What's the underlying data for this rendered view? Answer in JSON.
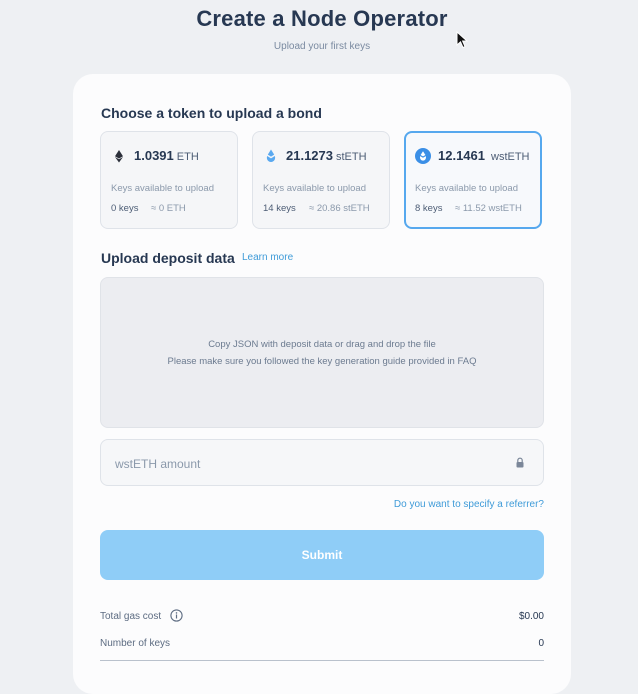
{
  "header": {
    "title": "Create a Node Operator",
    "subtitle": "Upload your first keys"
  },
  "bond": {
    "heading": "Choose a token to upload a bond",
    "tokens": [
      {
        "amount": "1.0391",
        "unit": "ETH",
        "available_label": "Keys available to upload",
        "keys": "0 keys",
        "equivalent": "≈ 0 ETH",
        "icon": "eth-icon",
        "selected": false
      },
      {
        "amount": "21.1273",
        "unit": "stETH",
        "available_label": "Keys available to upload",
        "keys": "14 keys",
        "equivalent": "≈ 20.86 stETH",
        "icon": "steth-icon",
        "selected": false
      },
      {
        "amount": "12.1461",
        "unit": "wstETH",
        "available_label": "Keys available to upload",
        "keys": "8 keys",
        "equivalent": "≈ 11.52 wstETH",
        "icon": "wsteth-icon",
        "selected": true
      }
    ]
  },
  "deposit": {
    "heading": "Upload deposit data",
    "learn_more": "Learn more",
    "dropzone_line1": "Copy JSON with deposit data or drag and drop the file",
    "dropzone_line2": "Please make sure you followed the key generation guide provided in FAQ"
  },
  "amount_input": {
    "value": "",
    "placeholder": "wstETH amount",
    "icon": "lock-icon"
  },
  "referrer_link": "Do you want to specify a referrer?",
  "submit_label": "Submit",
  "summary": {
    "gas_label": "Total gas cost",
    "gas_value": "$0.00",
    "keys_label": "Number of keys",
    "keys_value": "0"
  },
  "colors": {
    "accent": "#56a8ee",
    "submit_disabled": "#8fcdf7",
    "link": "#3f9bd8",
    "text": "#273852"
  }
}
